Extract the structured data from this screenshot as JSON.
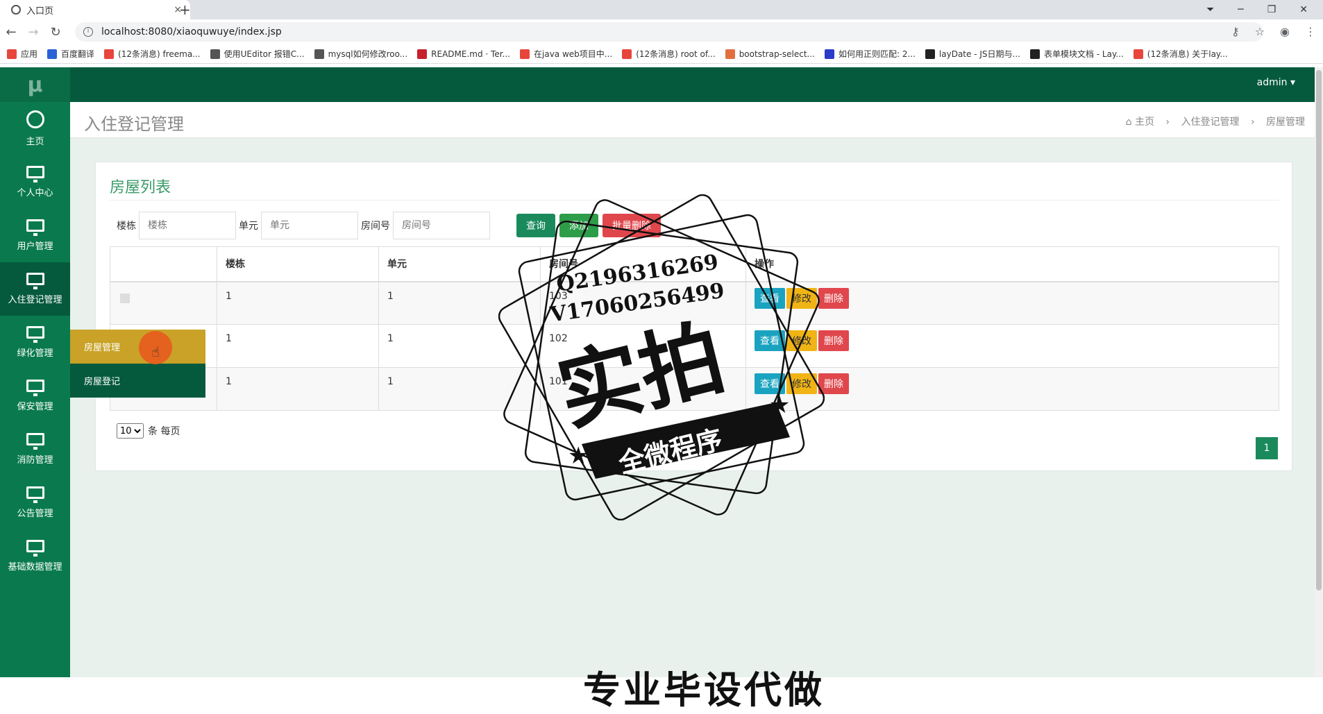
{
  "browser": {
    "tab_title": "入口页",
    "tab_close": "×",
    "new_tab": "+",
    "url": "localhost:8080/xiaoquwuye/index.jsp",
    "win": [
      "─",
      "❐",
      "✕"
    ],
    "bookmarks": [
      {
        "label": "应用",
        "color": "#e8453c"
      },
      {
        "label": "百度翻译",
        "color": "#2a62d8"
      },
      {
        "label": "(12条消息) freema...",
        "color": "#e8453c"
      },
      {
        "label": "使用UEditor 报错C...",
        "color": "#555555"
      },
      {
        "label": "mysql如何修改roo...",
        "color": "#555555"
      },
      {
        "label": "README.md · Ter...",
        "color": "#c7202c"
      },
      {
        "label": "在java web项目中...",
        "color": "#e8453c"
      },
      {
        "label": "(12条消息) root of...",
        "color": "#e8453c"
      },
      {
        "label": "bootstrap-select...",
        "color": "#e07040"
      },
      {
        "label": "如何用正则匹配: 2...",
        "color": "#2a3cc8"
      },
      {
        "label": "layDate - JS日期与...",
        "color": "#222222"
      },
      {
        "label": "表单模块文档 - Lay...",
        "color": "#222222"
      },
      {
        "label": "(12条消息) 关于lay...",
        "color": "#e8453c"
      }
    ]
  },
  "topbar": {
    "brand": "μ",
    "user": "admin ▾"
  },
  "sidebar": {
    "items": [
      {
        "label": "主页",
        "icon": "dashboard-icon"
      },
      {
        "label": "个人中心",
        "icon": "monitor-icon"
      },
      {
        "label": "用户管理",
        "icon": "monitor-icon"
      },
      {
        "label": "入住登记管理",
        "icon": "monitor-icon"
      },
      {
        "label": "绿化管理",
        "icon": "monitor-icon"
      },
      {
        "label": "保安管理",
        "icon": "monitor-icon"
      },
      {
        "label": "消防管理",
        "icon": "monitor-icon"
      },
      {
        "label": "公告管理",
        "icon": "monitor-icon"
      },
      {
        "label": "基础数据管理",
        "icon": "monitor-icon"
      }
    ],
    "submenu": [
      "房屋管理",
      "房屋登记"
    ]
  },
  "page": {
    "title": "入住登记管理",
    "breadcrumb": {
      "home": "主页",
      "sep": "›",
      "level1": "入住登记管理",
      "level2": "房屋管理"
    }
  },
  "card": {
    "title": "房屋列表",
    "filters": [
      {
        "label": "楼栋",
        "placeholder": "楼栋"
      },
      {
        "label": "单元",
        "placeholder": "单元"
      },
      {
        "label": "房间号",
        "placeholder": "房间号"
      }
    ],
    "buttons": {
      "query": "查询",
      "add": "添加",
      "batch_delete": "批量删除"
    },
    "columns": [
      "楼栋",
      "单元",
      "房间号",
      "操作"
    ],
    "rows": [
      {
        "building": "1",
        "unit": "1",
        "room": "103"
      },
      {
        "building": "1",
        "unit": "1",
        "room": "102"
      },
      {
        "building": "1",
        "unit": "1",
        "room": "101"
      }
    ],
    "row_actions": {
      "view": "查看",
      "edit": "修改",
      "delete": "删除"
    },
    "page_size": "10",
    "page_size_suffix": "条 每页",
    "current_page": "1"
  },
  "watermark": {
    "line1": "Q2196316269",
    "line2": "V17060256499",
    "big": "实拍",
    "banner": "全微程序",
    "bottom": "专业毕设代做"
  }
}
